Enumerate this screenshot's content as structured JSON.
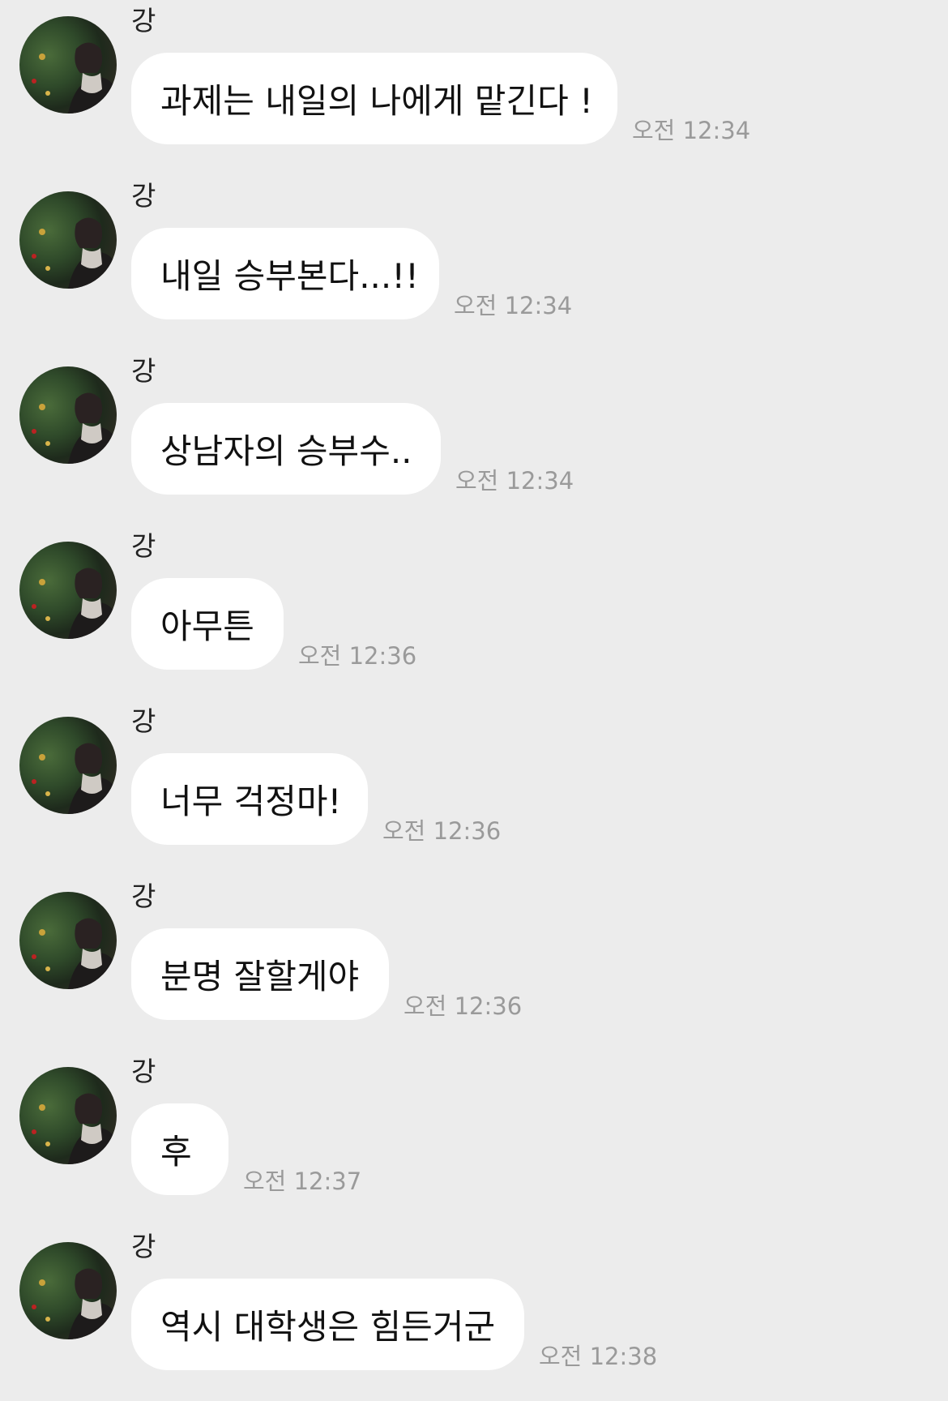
{
  "messages": [
    {
      "sender": "강",
      "text": "과제는 내일의 나에게 맡긴다 !",
      "time": "오전 12:34"
    },
    {
      "sender": "강",
      "text": "내일 승부본다...!!",
      "time": "오전 12:34"
    },
    {
      "sender": "강",
      "text": "상남자의 승부수..",
      "time": "오전 12:34"
    },
    {
      "sender": "강",
      "text": "아무튼",
      "time": "오전 12:36"
    },
    {
      "sender": "강",
      "text": "너무 걱정마!",
      "time": "오전 12:36"
    },
    {
      "sender": "강",
      "text": "분명 잘할게야",
      "time": "오전 12:36"
    },
    {
      "sender": "강",
      "text": "후",
      "time": "오전 12:37"
    },
    {
      "sender": "강",
      "text": "역시 대학생은 힘든거군",
      "time": "오전 12:38"
    }
  ],
  "colors": {
    "background": "#ececec",
    "bubble": "#ffffff",
    "time_text": "#9a9a9a"
  },
  "icons": {
    "avatar": "profile-photo"
  }
}
